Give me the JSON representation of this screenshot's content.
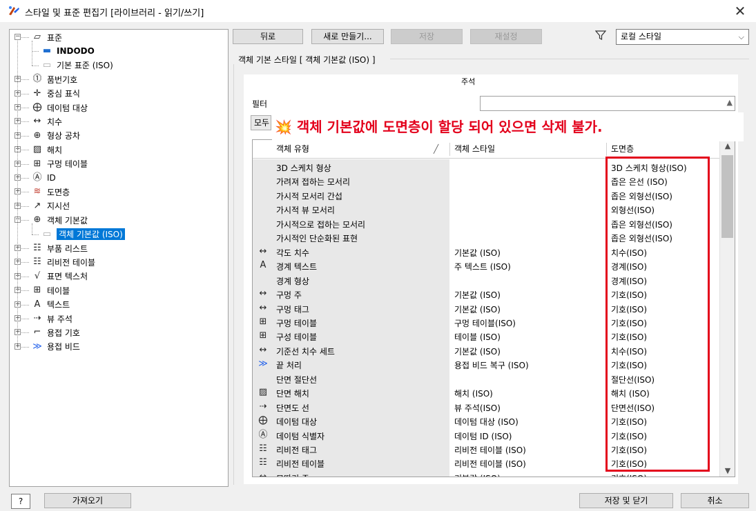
{
  "window": {
    "title": "스타일 및 표준 편집기 [라이브러리 - 읽기/쓰기]",
    "close_glyph": "✕"
  },
  "tree": {
    "items": [
      {
        "label": "표준",
        "icon": "standard-icon",
        "glyph": "▱",
        "expander": "−",
        "level": 0,
        "bold": false
      },
      {
        "label": "INDODO",
        "icon": "standard-blue-icon",
        "glyph": "▬",
        "expander": "",
        "level": 1,
        "bold": true
      },
      {
        "label": "기본 표준 (ISO)",
        "icon": "standard-gray-icon",
        "glyph": "▭",
        "expander": "",
        "level": 1,
        "bold": false
      },
      {
        "label": "품번기호",
        "icon": "balloon-icon",
        "glyph": "⓵",
        "expander": "+",
        "level": 0,
        "bold": false
      },
      {
        "label": "중심 표식",
        "icon": "center-mark-icon",
        "glyph": "✛",
        "expander": "+",
        "level": 0,
        "bold": false
      },
      {
        "label": "데이텀 대상",
        "icon": "datum-target-icon",
        "glyph": "⨁",
        "expander": "+",
        "level": 0,
        "bold": false
      },
      {
        "label": "치수",
        "icon": "dimension-icon",
        "glyph": "↔",
        "expander": "+",
        "level": 0,
        "bold": false
      },
      {
        "label": "형상 공차",
        "icon": "tolerance-icon",
        "glyph": "⊕",
        "expander": "+",
        "level": 0,
        "bold": false
      },
      {
        "label": "해치",
        "icon": "hatch-icon",
        "glyph": "▨",
        "expander": "+",
        "level": 0,
        "bold": false
      },
      {
        "label": "구멍 테이블",
        "icon": "hole-table-icon",
        "glyph": "⊞",
        "expander": "+",
        "level": 0,
        "bold": false
      },
      {
        "label": "ID",
        "icon": "id-icon",
        "glyph": "Ⓐ",
        "expander": "+",
        "level": 0,
        "bold": false
      },
      {
        "label": "도면층",
        "icon": "layer-icon",
        "glyph": "≋",
        "expander": "+",
        "level": 0,
        "bold": false
      },
      {
        "label": "지시선",
        "icon": "leader-icon",
        "glyph": "↗",
        "expander": "+",
        "level": 0,
        "bold": false
      },
      {
        "label": "객체 기본값",
        "icon": "object-defaults-icon",
        "glyph": "⊕",
        "expander": "−",
        "level": 0,
        "bold": false
      },
      {
        "label": "객체 기본값 (ISO)",
        "icon": "object-defaults-iso-icon",
        "glyph": "▭",
        "expander": "",
        "level": 1,
        "bold": false,
        "selected": true
      },
      {
        "label": "부품 리스트",
        "icon": "parts-list-icon",
        "glyph": "☷",
        "expander": "+",
        "level": 0,
        "bold": false
      },
      {
        "label": "리비전 테이블",
        "icon": "revision-table-icon",
        "glyph": "☷",
        "expander": "+",
        "level": 0,
        "bold": false
      },
      {
        "label": "표면 텍스처",
        "icon": "surface-texture-icon",
        "glyph": "√",
        "expander": "+",
        "level": 0,
        "bold": false
      },
      {
        "label": "테이블",
        "icon": "table-icon",
        "glyph": "⊞",
        "expander": "+",
        "level": 0,
        "bold": false
      },
      {
        "label": "텍스트",
        "icon": "text-icon",
        "glyph": "A",
        "expander": "+",
        "level": 0,
        "bold": false
      },
      {
        "label": "뷰 주석",
        "icon": "view-annotation-icon",
        "glyph": "⇢",
        "expander": "+",
        "level": 0,
        "bold": false
      },
      {
        "label": "용접 기호",
        "icon": "weld-symbol-icon",
        "glyph": "⌐",
        "expander": "+",
        "level": 0,
        "bold": false
      },
      {
        "label": "용접 비드",
        "icon": "weld-bead-icon",
        "glyph": "≫",
        "expander": "+",
        "level": 0,
        "bold": false
      }
    ]
  },
  "toolbar": {
    "back": "뒤로",
    "new": "새로 만들기...",
    "save": "저장",
    "reset": "재설정",
    "filter_value": "로컬 스타일",
    "caret": "⌵"
  },
  "main": {
    "section_label": "객체 기본 스타일 [ 객체 기본값 (ISO) ]",
    "annotation_label": "주석",
    "filter_label": "필터",
    "mode_button": "모두",
    "warning_emoji": "💥",
    "warning_text": "객체 기본값에 도면층이 할당 되어 있으면 삭제 불가.",
    "columns": {
      "type": "객체 유형",
      "style": "객체 스타일",
      "layer": "도면층"
    },
    "rows": [
      {
        "icon": "",
        "glyph": "",
        "type": "3D 스케치 형상",
        "style": "",
        "layer": "3D 스케치 형상(ISO)"
      },
      {
        "icon": "",
        "glyph": "",
        "type": "가려져 접하는 모서리",
        "style": "",
        "layer": "좁은 은선 (ISO)"
      },
      {
        "icon": "",
        "glyph": "",
        "type": "가시적 모서리 간섭",
        "style": "",
        "layer": "좁은 외형선(ISO)"
      },
      {
        "icon": "",
        "glyph": "",
        "type": "가시적 뷰 모서리",
        "style": "",
        "layer": "외형선(ISO)"
      },
      {
        "icon": "",
        "glyph": "",
        "type": "가시적으로 접하는 모서리",
        "style": "",
        "layer": "좁은 외형선(ISO)"
      },
      {
        "icon": "",
        "glyph": "",
        "type": "가시적인 단순화된 표현",
        "style": "",
        "layer": "좁은 외형선(ISO)"
      },
      {
        "icon": "dimension-icon",
        "glyph": "↔",
        "type": "각도 치수",
        "style": "기본값 (ISO)",
        "layer": "치수(ISO)"
      },
      {
        "icon": "text-icon",
        "glyph": "A",
        "type": "경계 텍스트",
        "style": "주 텍스트 (ISO)",
        "layer": "경계(ISO)"
      },
      {
        "icon": "",
        "glyph": "",
        "type": "경계 형상",
        "style": "",
        "layer": "경계(ISO)"
      },
      {
        "icon": "dimension-icon",
        "glyph": "↔",
        "type": "구멍 주",
        "style": "기본값 (ISO)",
        "layer": "기호(ISO)"
      },
      {
        "icon": "dimension-icon",
        "glyph": "↔",
        "type": "구멍 태그",
        "style": "기본값 (ISO)",
        "layer": "기호(ISO)"
      },
      {
        "icon": "hole-table-icon",
        "glyph": "⊞",
        "type": "구멍 테이블",
        "style": "구멍 테이블(ISO)",
        "layer": "기호(ISO)"
      },
      {
        "icon": "table-icon",
        "glyph": "⊞",
        "type": "구성 테이블",
        "style": "테이블 (ISO)",
        "layer": "기호(ISO)"
      },
      {
        "icon": "dimension-icon",
        "glyph": "↔",
        "type": "기준선 치수 세트",
        "style": "기본값 (ISO)",
        "layer": "치수(ISO)"
      },
      {
        "icon": "weld-bead-icon",
        "glyph": "≫",
        "type": "끝 처리",
        "style": "용접 비드 복구 (ISO)",
        "layer": "기호(ISO)"
      },
      {
        "icon": "",
        "glyph": "",
        "type": "단면 절단선",
        "style": "",
        "layer": "절단선(ISO)"
      },
      {
        "icon": "hatch-icon",
        "glyph": "▨",
        "type": "단면 해치",
        "style": "해치 (ISO)",
        "layer": "해치 (ISO)"
      },
      {
        "icon": "view-annotation-icon",
        "glyph": "⇢",
        "type": "단면도 선",
        "style": "뷰 주석(ISO)",
        "layer": "단면선(ISO)"
      },
      {
        "icon": "datum-target-icon",
        "glyph": "⨁",
        "type": "데이텀 대상",
        "style": "데이텀 대상 (ISO)",
        "layer": "기호(ISO)"
      },
      {
        "icon": "id-icon",
        "glyph": "Ⓐ",
        "type": "데이텀 식별자",
        "style": "데이텀 ID (ISO)",
        "layer": "기호(ISO)"
      },
      {
        "icon": "revision-table-icon",
        "glyph": "☷",
        "type": "리비전 태그",
        "style": "리비전 테이블 (ISO)",
        "layer": "기호(ISO)"
      },
      {
        "icon": "revision-table-icon",
        "glyph": "☷",
        "type": "리비전 테이블",
        "style": "리비전 테이블 (ISO)",
        "layer": "기호(ISO)"
      },
      {
        "icon": "dimension-icon",
        "glyph": "↔",
        "type": "모따기 주",
        "style": "기본값 (ISO)",
        "layer": "기호(ISO)"
      }
    ]
  },
  "footer": {
    "help": "?",
    "import": "가져오기",
    "save_close": "저장 및 닫기",
    "cancel": "취소"
  },
  "colors": {
    "accent": "#0078d7",
    "warning": "#e3001b"
  }
}
